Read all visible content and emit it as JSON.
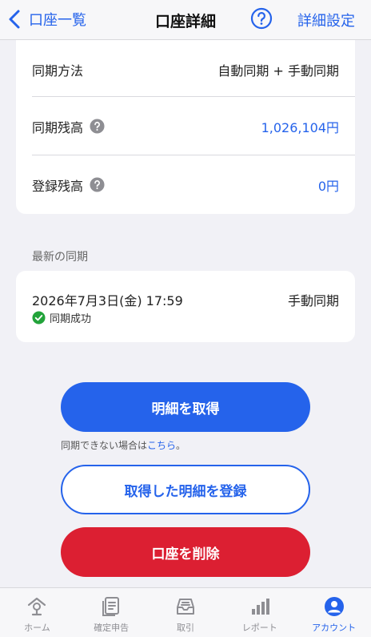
{
  "header": {
    "back_label": "口座一覧",
    "title": "口座詳細",
    "settings_label": "詳細設定"
  },
  "details": {
    "sync_method": {
      "label": "同期方法",
      "value": "自動同期 + 手動同期"
    },
    "synced_balance": {
      "label": "同期残高",
      "value": "1,026,104円"
    },
    "registered_balance": {
      "label": "登録残高",
      "value": "0円"
    }
  },
  "latest_sync": {
    "section_label": "最新の同期",
    "datetime": "2026年7月3日(金) 17:59",
    "type": "手動同期",
    "status": "同期成功"
  },
  "actions": {
    "fetch_label": "明細を取得",
    "note_prefix": "同期できない場合は",
    "note_link": "こちら",
    "note_suffix": "。",
    "register_label": "取得した明細を登録",
    "delete_label": "口座を削除"
  },
  "tabs": [
    {
      "label": "ホーム",
      "icon": "home-icon"
    },
    {
      "label": "確定申告",
      "icon": "document-icon"
    },
    {
      "label": "取引",
      "icon": "tray-icon"
    },
    {
      "label": "レポート",
      "icon": "bar-chart-icon"
    },
    {
      "label": "アカウント",
      "icon": "account-icon",
      "active": true
    }
  ],
  "colors": {
    "accent": "#2563eb",
    "danger": "#dc1f32",
    "success": "#22a33a",
    "background": "#f1f1f6"
  }
}
